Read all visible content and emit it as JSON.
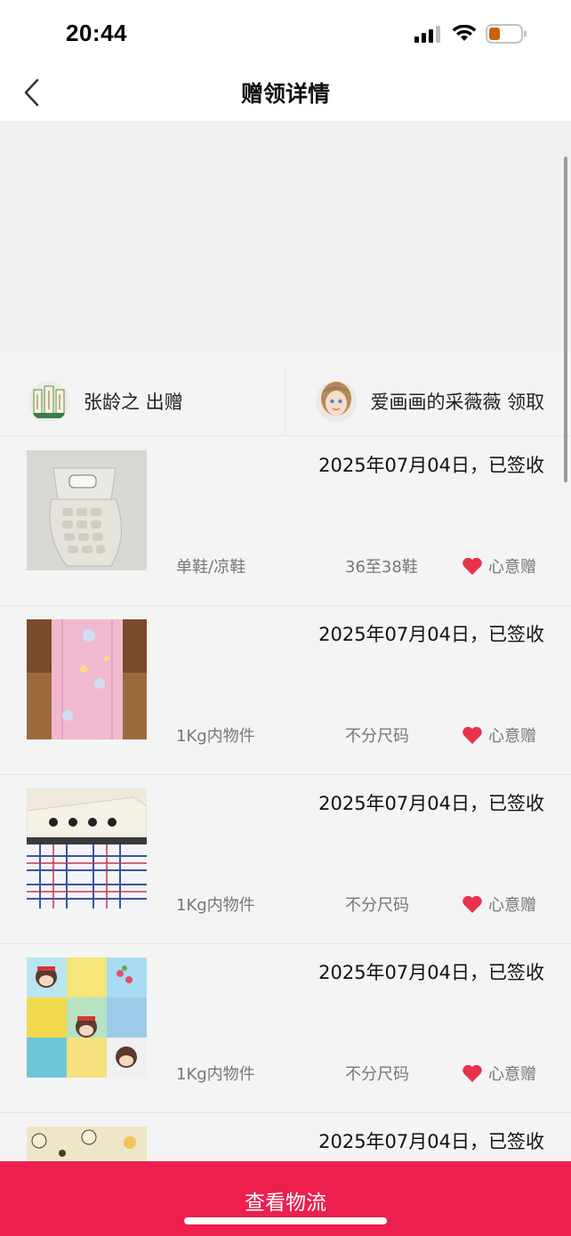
{
  "status_bar": {
    "time": "20:44"
  },
  "nav": {
    "title": "赠领详情"
  },
  "parties": {
    "giver": "张龄之 出赠",
    "receiver": "爱画画的采薇薇 领取"
  },
  "items": [
    {
      "date": "2025年07月04日，已签收",
      "category": "单鞋/凉鞋",
      "size": "36至38鞋",
      "gift_label": "心意赠"
    },
    {
      "date": "2025年07月04日，已签收",
      "category": "1Kg内物件",
      "size": "不分尺码",
      "gift_label": "心意赠"
    },
    {
      "date": "2025年07月04日，已签收",
      "category": "1Kg内物件",
      "size": "不分尺码",
      "gift_label": "心意赠"
    },
    {
      "date": "2025年07月04日，已签收",
      "category": "1Kg内物件",
      "size": "不分尺码",
      "gift_label": "心意赠"
    },
    {
      "date": "2025年07月04日，已签收"
    }
  ],
  "bottom_button": {
    "label": "查看物流"
  },
  "colors": {
    "accent": "#ec1f4f",
    "heart": "#e8334a"
  }
}
